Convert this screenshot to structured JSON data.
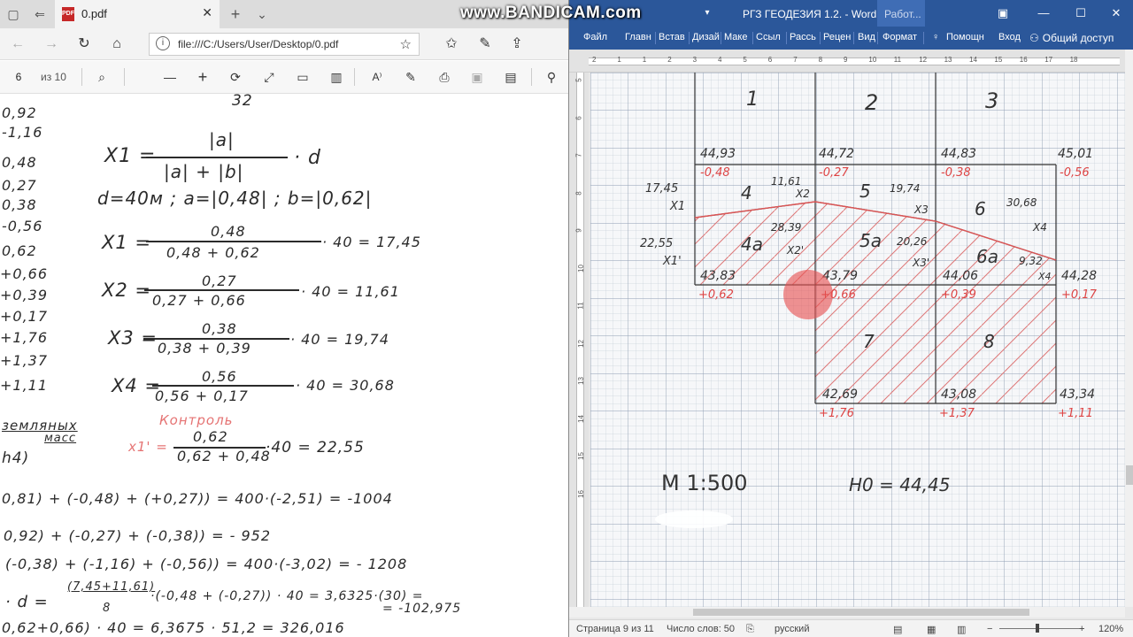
{
  "watermark": "www.BANDICAM.com",
  "browser": {
    "tab_title": "0.pdf",
    "address": "file:///C:/Users/User/Desktop/0.pdf",
    "page_current": "6",
    "page_of": "из 10",
    "icons": [
      "tab-set-aside-icon",
      "back-tabs-icon",
      "pdf-file-icon",
      "close-icon",
      "new-tab-icon",
      "chevron-down-icon",
      "back-icon",
      "forward-icon",
      "refresh-icon",
      "home-icon",
      "info-icon",
      "star-icon",
      "favorites-icon",
      "pen-icon",
      "share-icon",
      "search-icon",
      "zoom-out-icon",
      "zoom-in-icon",
      "rotate-icon",
      "fit-page-icon",
      "page-view-icon",
      "two-page-icon",
      "read-aloud-icon",
      "draw-icon",
      "print-icon",
      "save-icon",
      "save-as-icon",
      "pin-icon"
    ]
  },
  "pdf": {
    "top_frac_num": "32",
    "left_column": [
      "0,92",
      "-1,16",
      "0,48",
      "0,27",
      "0,38",
      "-0,56",
      "0,62",
      "+0,66",
      "+0,39",
      "+0,17",
      "+1,76",
      "+1,37",
      "+1,11"
    ],
    "formula_main_lhs": "X1 =",
    "formula_main_num": "|a|",
    "formula_main_den": "|a| + |b|",
    "formula_main_tail": "· d",
    "params": "d=40м ; a=|0,48| ; b=|0,62|",
    "x1_lhs": "X1 =",
    "x1_num": "0,48",
    "x1_den": "0,48 + 0,62",
    "x1_res": "· 40 = 17,45",
    "x2_lhs": "X2 =",
    "x2_num": "0,27",
    "x2_den": "0,27 + 0,66",
    "x2_res": "· 40 = 11,61",
    "x3_lhs": "X3 =",
    "x3_num": "0,38",
    "x3_den": "0,38 + 0,39",
    "x3_res": "· 40 = 19,74",
    "x4_lhs": "X4 =",
    "x4_num": "0,56",
    "x4_den": "0,56 + 0,17",
    "x4_res": "· 40 = 30,68",
    "earth_1": "земляных",
    "earth_2": "масс",
    "h4": "h4)",
    "control_label": "Контроль",
    "xc_lhs": "x1' =",
    "xc_num": "0,62",
    "xc_den": "0,62 + 0,48",
    "xc_res": "·40 = 22,55",
    "line_1": "0,81) + (-0,48) + (+0,27)) = 400·(-2,51) = -1004",
    "line_2": "0,92) + (-0,27) + (-0,38)) = - 952",
    "line_3": "(-0,38) + (-1,16) + (-0,56)) = 400·(-3,02) = - 1208",
    "line_4a": "· d =",
    "line_4_num": "(7,45+11,61)",
    "line_4_den": "8",
    "line_4b": "·(-0,48 + (-0,27)) · 40 = 3,6325·(30) =",
    "line_4c": "= -102,975",
    "line_5": "0,62+0,66) · 40 = 6,3675 · 51,2 = 326,016"
  },
  "word": {
    "title": "РГЗ ГЕОДЕЗИЯ 1.2. - Word",
    "work_label": "Работ...",
    "tabs": [
      "Файл",
      "Главн",
      "Встав",
      "Дизай",
      "Маке",
      "Ссыл",
      "Рассь",
      "Рецен",
      "Вид",
      "Формат"
    ],
    "help": "Помощн",
    "login": "Вход",
    "share": "Общий доступ",
    "ruler_h": [
      "2",
      "1",
      "1",
      "2",
      "3",
      "4",
      "5",
      "6",
      "7",
      "8",
      "9",
      "10",
      "11",
      "12",
      "13",
      "14",
      "15",
      "16",
      "17",
      "18"
    ],
    "ruler_v": [
      "5",
      "6",
      "7",
      "8",
      "9",
      "10",
      "11",
      "12",
      "13",
      "14",
      "15",
      "16"
    ],
    "status": {
      "page": "Страница 9 из 11",
      "words": "Число слов: 50",
      "lang": "русский",
      "zoom": "120%"
    }
  },
  "plan": {
    "columns": [
      "1",
      "2",
      "3"
    ],
    "cells": [
      "4",
      "5",
      "6",
      "4а",
      "5а",
      "6а",
      "7",
      "8"
    ],
    "heights_top": [
      "44,93",
      "44,72",
      "44,83",
      "45,01"
    ],
    "work_top": [
      "-0,48",
      "-0,27",
      "-0,38",
      "-0,56"
    ],
    "heights_mid": [
      "43,83",
      "43,79",
      "44,06",
      "44,28"
    ],
    "work_mid": [
      "+0,62",
      "+0,66",
      "+0,39",
      "+0,17"
    ],
    "heights_bot": [
      "42,69",
      "43,08",
      "43,34"
    ],
    "work_bot": [
      "+1,76",
      "+1,37",
      "+1,11"
    ],
    "labels": [
      "17,45",
      "X1",
      "22,55",
      "X1'",
      "11,61",
      "X2",
      "28,39",
      "X2'",
      "19,74",
      "X3",
      "20,26",
      "X3'",
      "30,68",
      "X4",
      "9,32",
      "X4"
    ],
    "scale": "М 1:500",
    "h0": "H0 = 44,45"
  }
}
